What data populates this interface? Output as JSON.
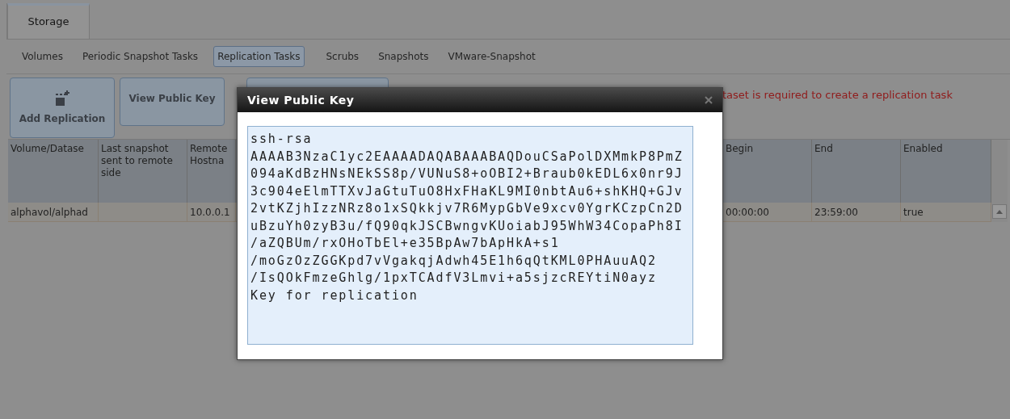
{
  "top_tabs": [
    {
      "label": "Storage",
      "selected": true
    }
  ],
  "nav": [
    {
      "label": "Volumes",
      "selected": false
    },
    {
      "label": "Periodic Snapshot Tasks",
      "selected": false
    },
    {
      "label": "Replication Tasks",
      "selected": true
    },
    {
      "label": "Scrubs",
      "selected": false
    },
    {
      "label": "Snapshots",
      "selected": false
    },
    {
      "label": "VMware-Snapshot",
      "selected": false
    }
  ],
  "toolbar": {
    "buttons": [
      {
        "kind": "icon",
        "label": "Add Replication"
      },
      {
        "kind": "text",
        "label": "View Public Key"
      },
      {
        "kind": "blank"
      }
    ],
    "message": "taset is required to create a replication task"
  },
  "table": {
    "columns": [
      "Volume/Datase",
      "Last snapshot sent to remote side",
      "Remote Hostna",
      "Begin",
      "End",
      "Enabled"
    ],
    "rows": [
      [
        "alphavol/alphad",
        "",
        "10.0.0.1",
        "00:00:00",
        "23:59:00",
        "true"
      ]
    ]
  },
  "dialog": {
    "title": "View Public Key",
    "key_lines": [
      "ssh-rsa",
      "AAAAB3NzaC1yc2EAAAADAQABAAABAQDouCSaPolDXMmkP8PmZ",
      "094aKdBzHNsNEkSS8p/VUNuS8+oOBI2+Braub0kEDL6x0nr9J",
      "3c904eElmTTXvJaGtuTuO8HxFHaKL9MI0nbtAu6+shKHQ+GJv",
      "2vtKZjhIzzNRz8o1xSQkkjv7R6MypGbVe9xcv0YgrKCzpCn2D",
      "uBzuYh0zyB3u/fQ90qkJSCBwngvKUoiabJ95WhW34CopaPh8I",
      "/aZQBUm/rxOHoTbEl+e35BpAw7bApHkA+s1",
      "/moGzOzZGGKpd7vVgakqjAdwh45E1h6qQtKML0PHAuuAQ2",
      "/IsQOkFmzeGhlg/1pxTCAdfV3Lmvi+a5sjzcREYtiN0ayz",
      "Key for replication"
    ]
  }
}
